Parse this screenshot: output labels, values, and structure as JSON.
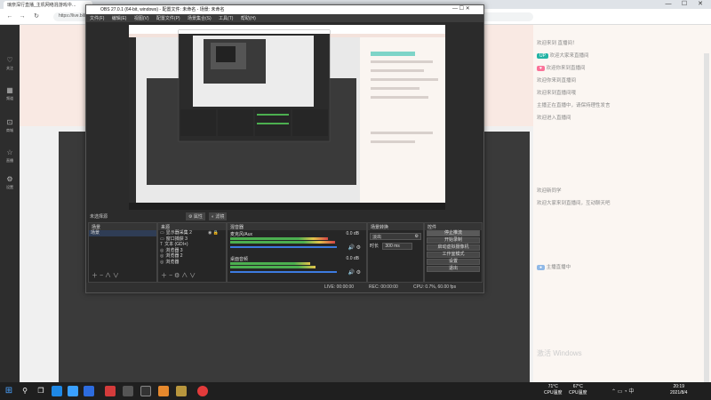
{
  "browser": {
    "tab_title": "璃奈深行直播_主机网络混游戏中…",
    "url": "https://live.bilibili.com/...",
    "window_controls": [
      "—",
      "☐",
      "✕"
    ]
  },
  "sidebar": {
    "items": [
      {
        "icon": "heart-icon",
        "label": "关注"
      },
      {
        "icon": "grid-icon",
        "label": "频道"
      },
      {
        "icon": "bag-icon",
        "label": "商城"
      },
      {
        "icon": "star-icon",
        "label": "直播"
      },
      {
        "icon": "settings-icon",
        "label": "设置"
      }
    ]
  },
  "obs": {
    "title": "OBS 27.0.1 (64-bit, windows) - 配置文件: 未命名 - 场景: 未命名",
    "menu": [
      "文件(F)",
      "编辑(E)",
      "视图(V)",
      "配置文件(P)",
      "场景集合(S)",
      "工具(T)",
      "帮助(H)"
    ],
    "scene_label": "未选择源",
    "properties_label": "属性",
    "filters_label": "滤镜",
    "docks": {
      "scenes": "场景",
      "sources": "来源",
      "mixer": "混音器",
      "transitions": "场景转换",
      "controls": "控件"
    },
    "scene_items": [
      "场景"
    ],
    "source_items": [
      "显示器采集 2",
      "窗口捕获 3",
      "文本 (GDI+)",
      "浏览器 3",
      "浏览器 2",
      "浏览器"
    ],
    "mixer_tracks": [
      {
        "name": "麦克风/Aux",
        "db": "0.0 dB"
      },
      {
        "name": "桌面音频",
        "db": "0.0 dB"
      }
    ],
    "transition": {
      "type": "淡出",
      "duration_label": "时长",
      "duration": "300 ms"
    },
    "controls": [
      "停止推流",
      "开始录制",
      "启动虚拟摄像机",
      "工作室模式",
      "设置",
      "退出"
    ],
    "status_bar": "LIVE: 00:00:00   REC: 00:00:00   CPU: 0.7%, 60.00 fps",
    "status": {
      "live_label": "LIVE:",
      "live_time": "00:00:00",
      "rec_label": "REC:",
      "rec_time": "00:00:00",
      "cpu": "CPU: 0.7%, 60.00 fps"
    }
  },
  "right_panel": {
    "lines": [
      "欢迎来到 直播间！",
      "欢迎大家来直播间",
      "欢迎你来到直播间",
      "欢迎你来到直播间",
      "欢迎来到直播间哦",
      "主播正在直播中，请保持理性发言",
      "欢迎进入直播间",
      "欢迎新同学",
      "欢迎大家来到直播间，互动聊天吧",
      "主播直播中"
    ],
    "watermark": "激活 Windows"
  },
  "taskbar": {
    "weather": "71°C",
    "weather_label": "CPU温度",
    "cpu": "67°C",
    "cpu_label": "CPU温度",
    "time": "20:19",
    "date": "2021/8/4"
  },
  "colors": {
    "accent": "#fb7299",
    "obs_bg": "#2b2b2b",
    "meter_green": "#4caf50",
    "meter_yellow": "#e3c44a",
    "meter_red": "#d64545"
  }
}
